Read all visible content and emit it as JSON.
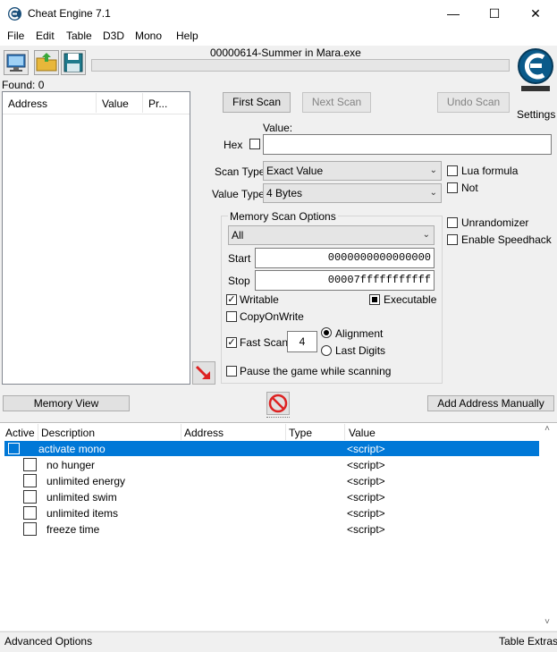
{
  "window": {
    "title": "Cheat Engine 7.1",
    "minimize": "—",
    "maximize": "☐",
    "close": "✕"
  },
  "menu": [
    "File",
    "Edit",
    "Table",
    "D3D",
    "Mono",
    "Help"
  ],
  "process_name": "00000614-Summer in Mara.exe",
  "found_label": "Found: 0",
  "results_columns": [
    "Address",
    "Value",
    "Pr..."
  ],
  "scan": {
    "first_scan": "First Scan",
    "next_scan": "Next Scan",
    "undo_scan": "Undo Scan",
    "settings": "Settings",
    "value_label": "Value:",
    "hex_label": "Hex",
    "scan_type_label": "Scan Type",
    "scan_type_value": "Exact Value",
    "value_type_label": "Value Type",
    "value_type_value": "4 Bytes",
    "lua_formula": "Lua formula",
    "not_label": "Not",
    "unrandomizer": "Unrandomizer",
    "enable_speedhack": "Enable Speedhack"
  },
  "memory_options": {
    "title": "Memory Scan Options",
    "region": "All",
    "start_label": "Start",
    "start_value": "0000000000000000",
    "stop_label": "Stop",
    "stop_value": "00007fffffffffff",
    "writable": "Writable",
    "executable": "Executable",
    "copy_on_write": "CopyOnWrite",
    "fast_scan": "Fast Scan",
    "fast_scan_value": "4",
    "alignment": "Alignment",
    "last_digits": "Last Digits",
    "pause_game": "Pause the game while scanning"
  },
  "buttons": {
    "memory_view": "Memory View",
    "add_address": "Add Address Manually"
  },
  "table_columns": [
    "Active",
    "Description",
    "Address",
    "Type",
    "Value"
  ],
  "table_rows": [
    {
      "description": "activate mono",
      "value": "<script>"
    },
    {
      "description": "no hunger",
      "value": "<script>"
    },
    {
      "description": "unlimited energy",
      "value": "<script>"
    },
    {
      "description": "unlimited swim",
      "value": "<script>"
    },
    {
      "description": "unlimited items",
      "value": "<script>"
    },
    {
      "description": "freeze time",
      "value": "<script>"
    }
  ],
  "footer": {
    "advanced_options": "Advanced Options",
    "table_extras": "Table Extras"
  },
  "colors": {
    "selection": "#0078d7",
    "accent": "#0060a0"
  }
}
